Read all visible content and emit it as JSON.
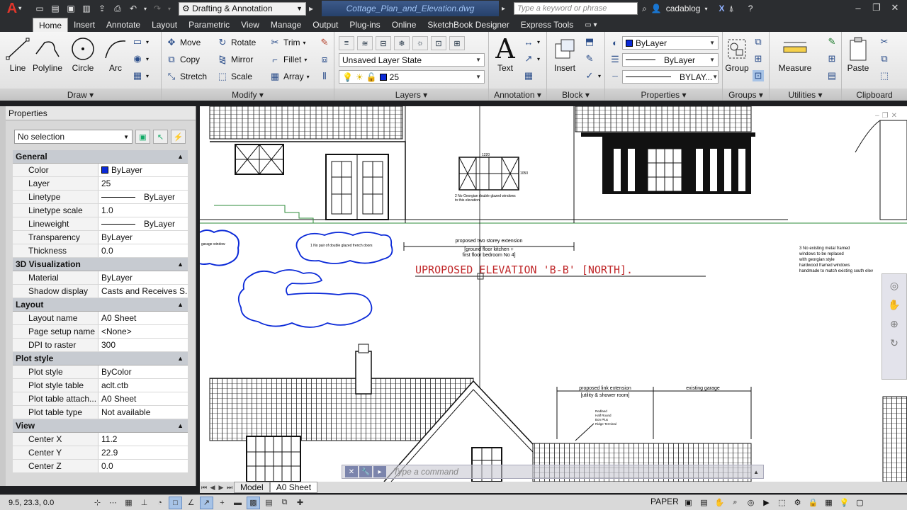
{
  "title_bar": {
    "app_logo": "A",
    "workspace": "Drafting & Annotation",
    "document_title": "Cottage_Plan_and_Elevation.dwg",
    "search_placeholder": "Type a keyword or phrase",
    "user_name": "cadablog"
  },
  "ribbon_tabs": [
    "Home",
    "Insert",
    "Annotate",
    "Layout",
    "Parametric",
    "View",
    "Manage",
    "Output",
    "Plug-ins",
    "Online",
    "SketchBook Designer",
    "Express Tools"
  ],
  "ribbon": {
    "draw": {
      "title": "Draw",
      "line": "Line",
      "polyline": "Polyline",
      "circle": "Circle",
      "arc": "Arc"
    },
    "modify": {
      "title": "Modify",
      "move": "Move",
      "rotate": "Rotate",
      "trim": "Trim",
      "copy": "Copy",
      "mirror": "Mirror",
      "fillet": "Fillet",
      "stretch": "Stretch",
      "scale": "Scale",
      "array": "Array"
    },
    "layers": {
      "title": "Layers",
      "layer_state": "Unsaved Layer State",
      "current_layer": "25"
    },
    "annotation": {
      "title": "Annotation",
      "text": "Text"
    },
    "block": {
      "title": "Block",
      "insert": "Insert"
    },
    "properties": {
      "title": "Properties",
      "color": "ByLayer",
      "lineweight": "ByLayer",
      "linetype": "BYLAY..."
    },
    "groups": {
      "title": "Groups",
      "group": "Group"
    },
    "utilities": {
      "title": "Utilities",
      "measure": "Measure"
    },
    "clipboard": {
      "title": "Clipboard",
      "paste": "Paste"
    }
  },
  "properties_palette": {
    "header": "Properties",
    "selection": "No selection",
    "sections": {
      "general": {
        "title": "General",
        "color": {
          "k": "Color",
          "v": "ByLayer"
        },
        "layer": {
          "k": "Layer",
          "v": "25"
        },
        "linetype": {
          "k": "Linetype",
          "v": "ByLayer"
        },
        "linetype_scale": {
          "k": "Linetype scale",
          "v": "1.0"
        },
        "lineweight": {
          "k": "Lineweight",
          "v": "ByLayer"
        },
        "transparency": {
          "k": "Transparency",
          "v": "ByLayer"
        },
        "thickness": {
          "k": "Thickness",
          "v": "0.0"
        }
      },
      "viz3d": {
        "title": "3D Visualization",
        "material": {
          "k": "Material",
          "v": "ByLayer"
        },
        "shadow": {
          "k": "Shadow display",
          "v": "Casts and Receives S..."
        }
      },
      "layout": {
        "title": "Layout",
        "layout_name": {
          "k": "Layout name",
          "v": "A0 Sheet"
        },
        "page_setup": {
          "k": "Page setup name",
          "v": "<None>"
        },
        "dpi": {
          "k": "DPI to raster",
          "v": "300"
        }
      },
      "plot_style": {
        "title": "Plot style",
        "plot_style": {
          "k": "Plot style",
          "v": "ByColor"
        },
        "plot_style_table": {
          "k": "Plot style table",
          "v": "aclt.ctb"
        },
        "plot_table_attach": {
          "k": "Plot table attach...",
          "v": "A0 Sheet"
        },
        "plot_table_type": {
          "k": "Plot table type",
          "v": "Not available"
        }
      },
      "view": {
        "title": "View",
        "center_x": {
          "k": "Center X",
          "v": "11.2"
        },
        "center_y": {
          "k": "Center Y",
          "v": "22.9"
        },
        "center_z": {
          "k": "Center Z",
          "v": "0.0"
        }
      }
    }
  },
  "drawing": {
    "elevation_title": "UPROPOSED ELEVATION 'B-B' [NORTH].",
    "note_extension": "proposed two storey extension",
    "note_kitchen": "[ground floor kitchen +",
    "note_bedroom": "first floor bedroom No 4]",
    "note_window2": "2 No Georgian double glazed windows",
    "note_window2b": "to this elevation",
    "note_french": "1 No pair of double glazed french doors",
    "note_existing_1": "3 No existing metal framed",
    "note_existing_2": "windows to be replaced",
    "note_existing_3": "with georgian style",
    "note_existing_4": "hardwood framed windows",
    "note_existing_5": "handmade to match existing south elev",
    "note_garage_window": "garage window",
    "note_link": "proposed link extension",
    "note_utility": "[utility & shower room]",
    "note_garage": "existing garage",
    "roof_note_1": "Redland",
    "roof_note_2": "Half Round",
    "roof_note_3": "Bon Plus",
    "roof_note_4": "Ridge Terminal",
    "dim_1220": "1220",
    "dim_1050": "1050"
  },
  "command_line": {
    "placeholder": "Type a command"
  },
  "layout_tabs": [
    "Model",
    "A0 Sheet"
  ],
  "status": {
    "coords": "9.5, 23.3, 0.0",
    "space": "PAPER"
  },
  "colors": {
    "accent_blue": "#0b2ad8",
    "title_red": "#c0282a",
    "green": "#2e8b3a"
  }
}
